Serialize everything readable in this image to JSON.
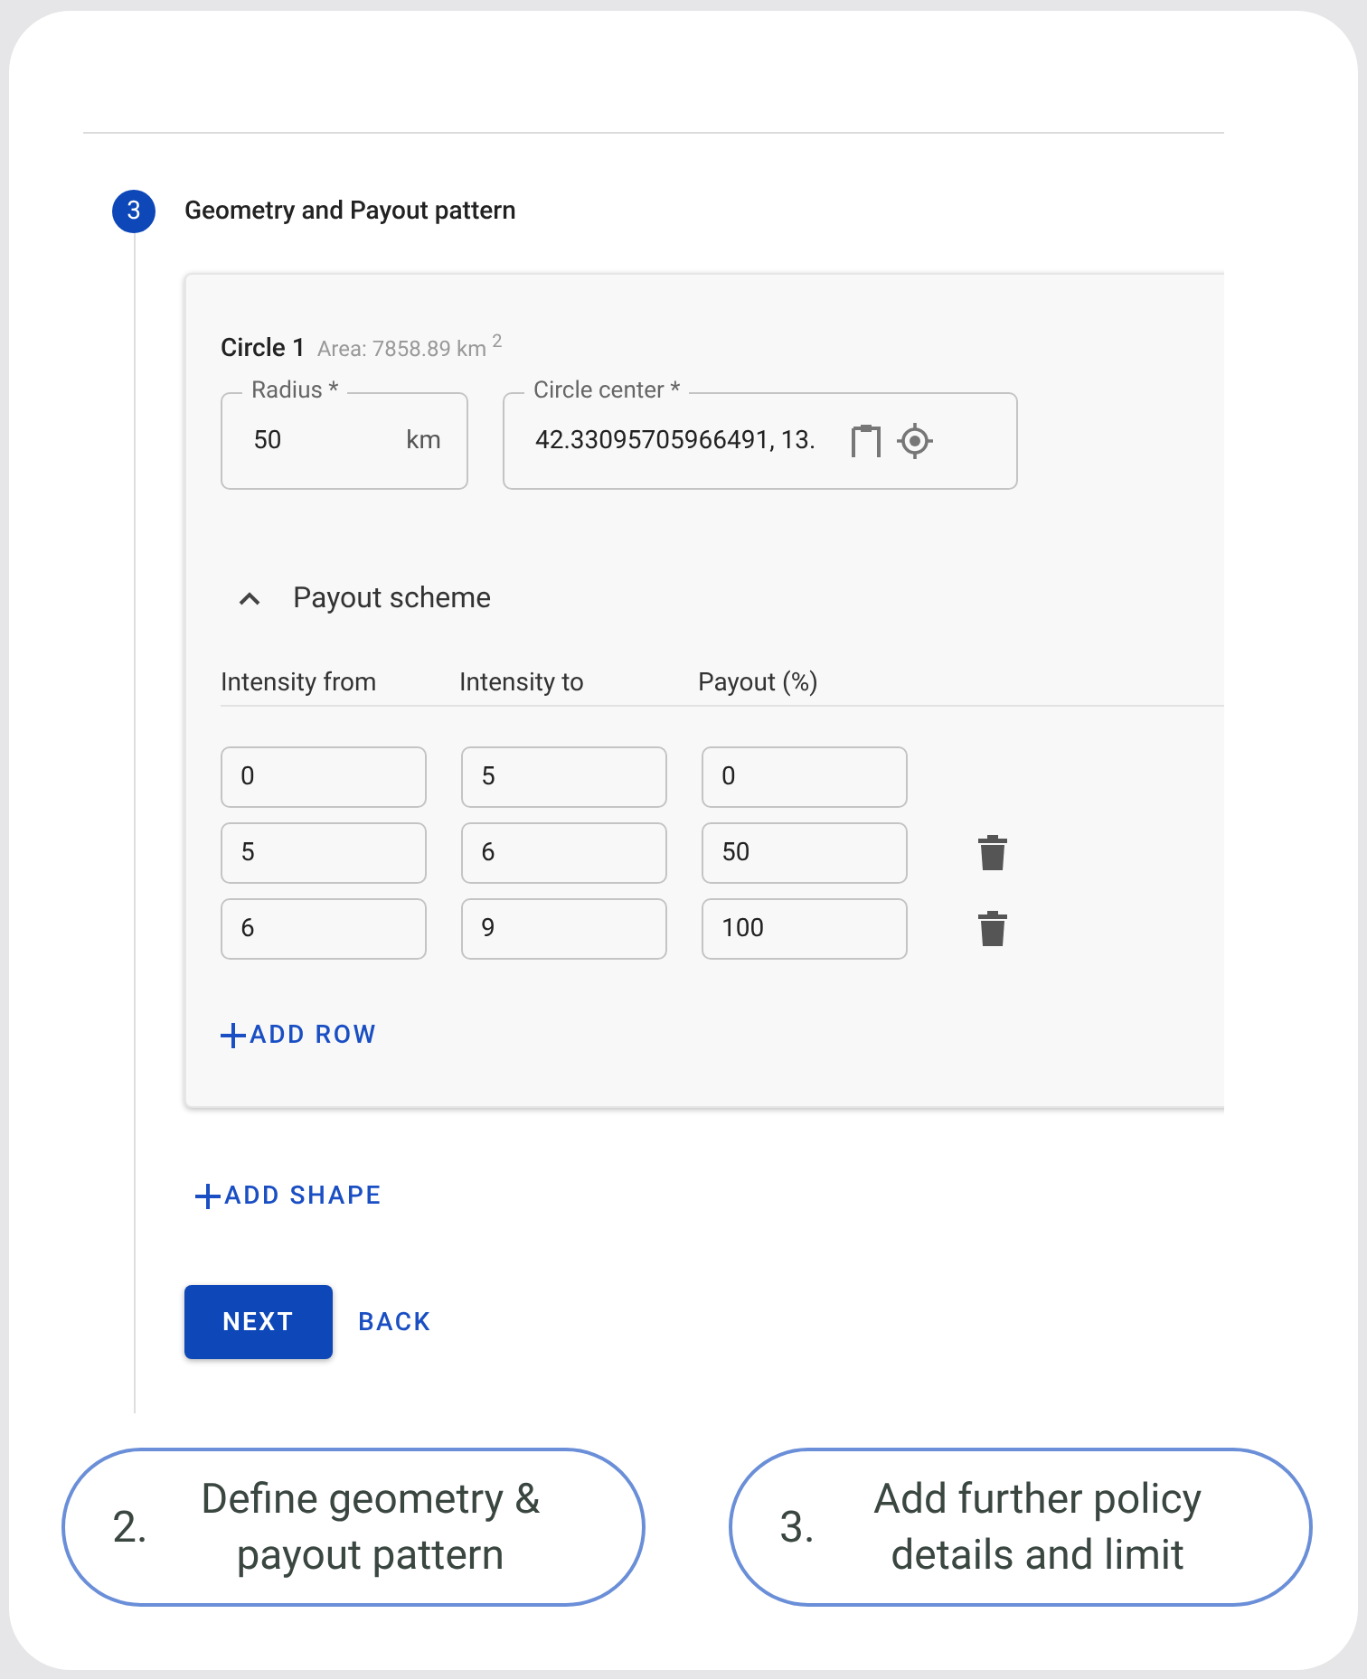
{
  "step": {
    "number": "3",
    "title": "Geometry and Payout pattern"
  },
  "shape": {
    "title": "Circle 1",
    "area": "Area: 7858.89 km $^{2}$",
    "fields": [
      {
        "kind": "unit",
        "label": "Radius *",
        "value": "50",
        "suffix": "km"
      },
      {
        "kind": "location",
        "label": "Circle center *",
        "value": "42.33095705966491, 13."
      }
    ]
  },
  "payout_scheme": {
    "title": "Payout scheme",
    "expanded": true,
    "columns": [
      "Intensity from",
      "Intensity to",
      "Payout (%)"
    ],
    "rows": [
      {
        "cells": [
          "0",
          "5",
          "0"
        ],
        "deletable": false
      },
      {
        "cells": [
          "5",
          "6",
          "50"
        ],
        "deletable": true
      },
      {
        "cells": [
          "6",
          "9",
          "100"
        ],
        "deletable": true
      }
    ],
    "add_row": "ADD ROW"
  },
  "add_shape": "ADD SHAPE",
  "buttons": [
    {
      "label": "NEXT",
      "kind": "primary"
    },
    {
      "label": "BACK",
      "kind": "text"
    }
  ],
  "callouts": [
    {
      "number": "2.",
      "text": "Define geometry & payout pattern"
    },
    {
      "number": "3.",
      "text": "Add further policy details and limit"
    }
  ]
}
